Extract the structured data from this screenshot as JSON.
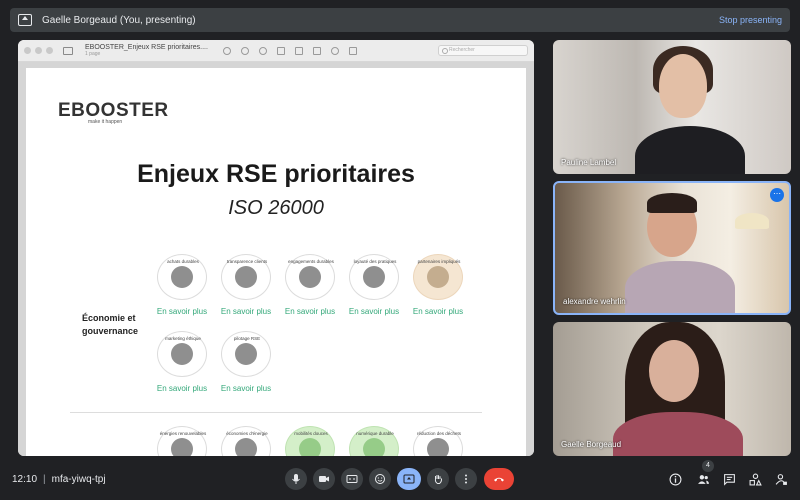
{
  "presenting_bar": {
    "title": "Gaelle Borgeaud (You, presenting)",
    "stop_label": "Stop presenting"
  },
  "viewer": {
    "doc_title": "EBOOSTER_Enjeux RSE prioritaires....",
    "doc_pages": "1 page",
    "search_placeholder": "Rechercher"
  },
  "slide": {
    "logo": "EBOOSTER",
    "logo_tagline": "make it happen",
    "title": "Enjeux RSE prioritaires",
    "subtitle": "ISO 26000",
    "section_label_line1": "Économie et",
    "section_label_line2": "gouvernance",
    "more_label": "En savoir plus",
    "row1": [
      {
        "label": "achats durables",
        "style": "gray"
      },
      {
        "label": "transparence clients",
        "style": "gray"
      },
      {
        "label": "engagements durables",
        "style": "gray"
      },
      {
        "label": "loyauté des pratiques",
        "style": "gray"
      },
      {
        "label": "partenaires impliqués",
        "style": "beige"
      }
    ],
    "row2": [
      {
        "label": "marketing éthique",
        "style": "gray"
      },
      {
        "label": "pilotage RSE",
        "style": "gray"
      }
    ],
    "row3": [
      {
        "label": "énergies renouvelables",
        "style": "gray"
      },
      {
        "label": "économies d'énergie",
        "style": "gray"
      },
      {
        "label": "mobilités douces",
        "style": "green"
      },
      {
        "label": "numérique durable",
        "style": "green"
      },
      {
        "label": "réduction des déchets",
        "style": "gray"
      }
    ]
  },
  "participants": [
    {
      "name": "Pauline Lambel"
    },
    {
      "name": "alexandre wehrlin"
    },
    {
      "name": "Gaelle Borgeaud"
    }
  ],
  "meeting": {
    "time": "12:10",
    "separator": "|",
    "code": "mfa-yiwq-tpj",
    "participant_count": "4"
  },
  "colors": {
    "accent": "#8ab4f8",
    "end_call": "#ea4335",
    "link_green": "#34a87a"
  }
}
